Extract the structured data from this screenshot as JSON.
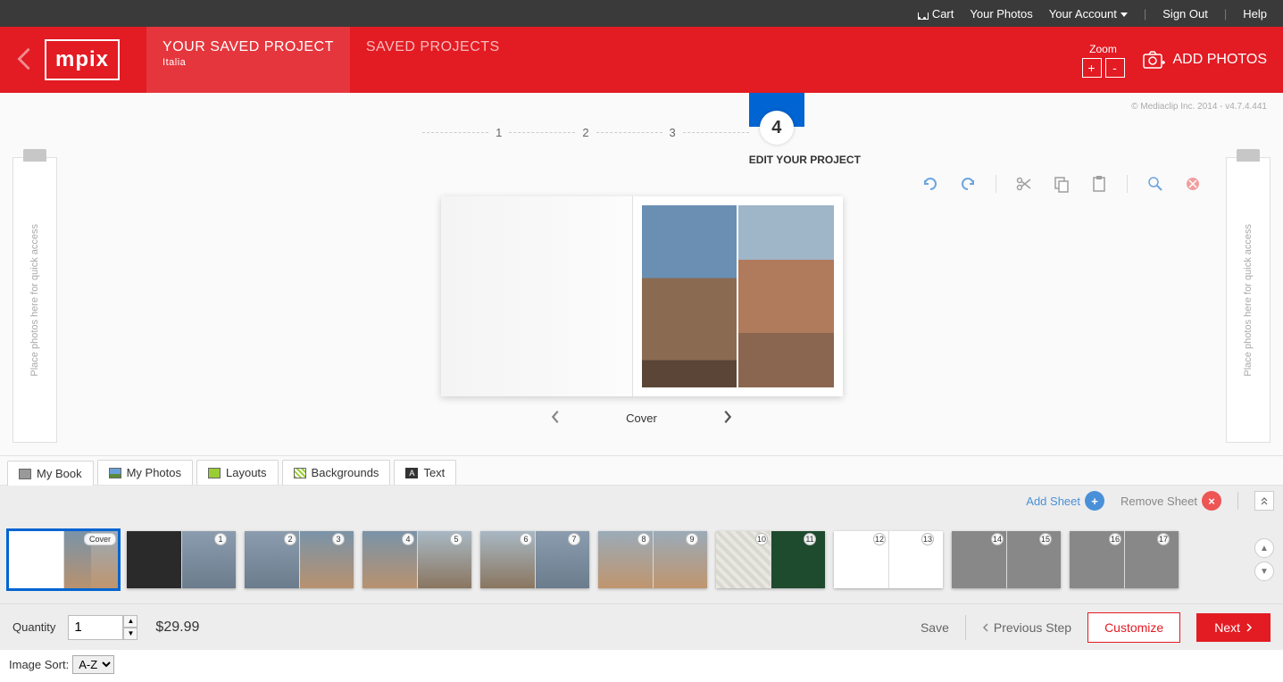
{
  "topbar": {
    "cart": "Cart",
    "your_photos": "Your Photos",
    "your_account": "Your Account",
    "sign_out": "Sign Out",
    "help": "Help"
  },
  "header": {
    "logo": "mpix",
    "tab_active_title": "YOUR SAVED PROJECT",
    "tab_active_sub": "Italia",
    "tab_saved": "SAVED PROJECTS",
    "zoom_label": "Zoom",
    "zoom_in": "+",
    "zoom_out": "-",
    "add_photos": "ADD PHOTOS"
  },
  "workspace": {
    "copyright": "© Mediaclip Inc. 2014 - v4.7.4.441",
    "steps": {
      "s1": "1",
      "s2": "2",
      "s3": "3",
      "s4": "4",
      "label": "EDIT YOUR PROJECT"
    },
    "tray_text": "Place photos here for quick access",
    "pager_label": "Cover"
  },
  "panel_tabs": {
    "my_book": "My Book",
    "my_photos": "My Photos",
    "layouts": "Layouts",
    "backgrounds": "Backgrounds",
    "text": "Text"
  },
  "sheet_actions": {
    "add": "Add Sheet",
    "remove": "Remove Sheet"
  },
  "thumbs": {
    "cover": "Cover",
    "pages": [
      "1",
      "2",
      "3",
      "4",
      "5",
      "6",
      "7",
      "8",
      "9",
      "10",
      "11",
      "12",
      "13",
      "14",
      "15",
      "16",
      "17"
    ]
  },
  "actionbar": {
    "qty_label": "Quantity",
    "qty_value": "1",
    "price": "$29.99",
    "save": "Save",
    "prev": "Previous Step",
    "customize": "Customize",
    "next": "Next"
  },
  "sort": {
    "label": "Image Sort:",
    "value": "A-Z"
  }
}
